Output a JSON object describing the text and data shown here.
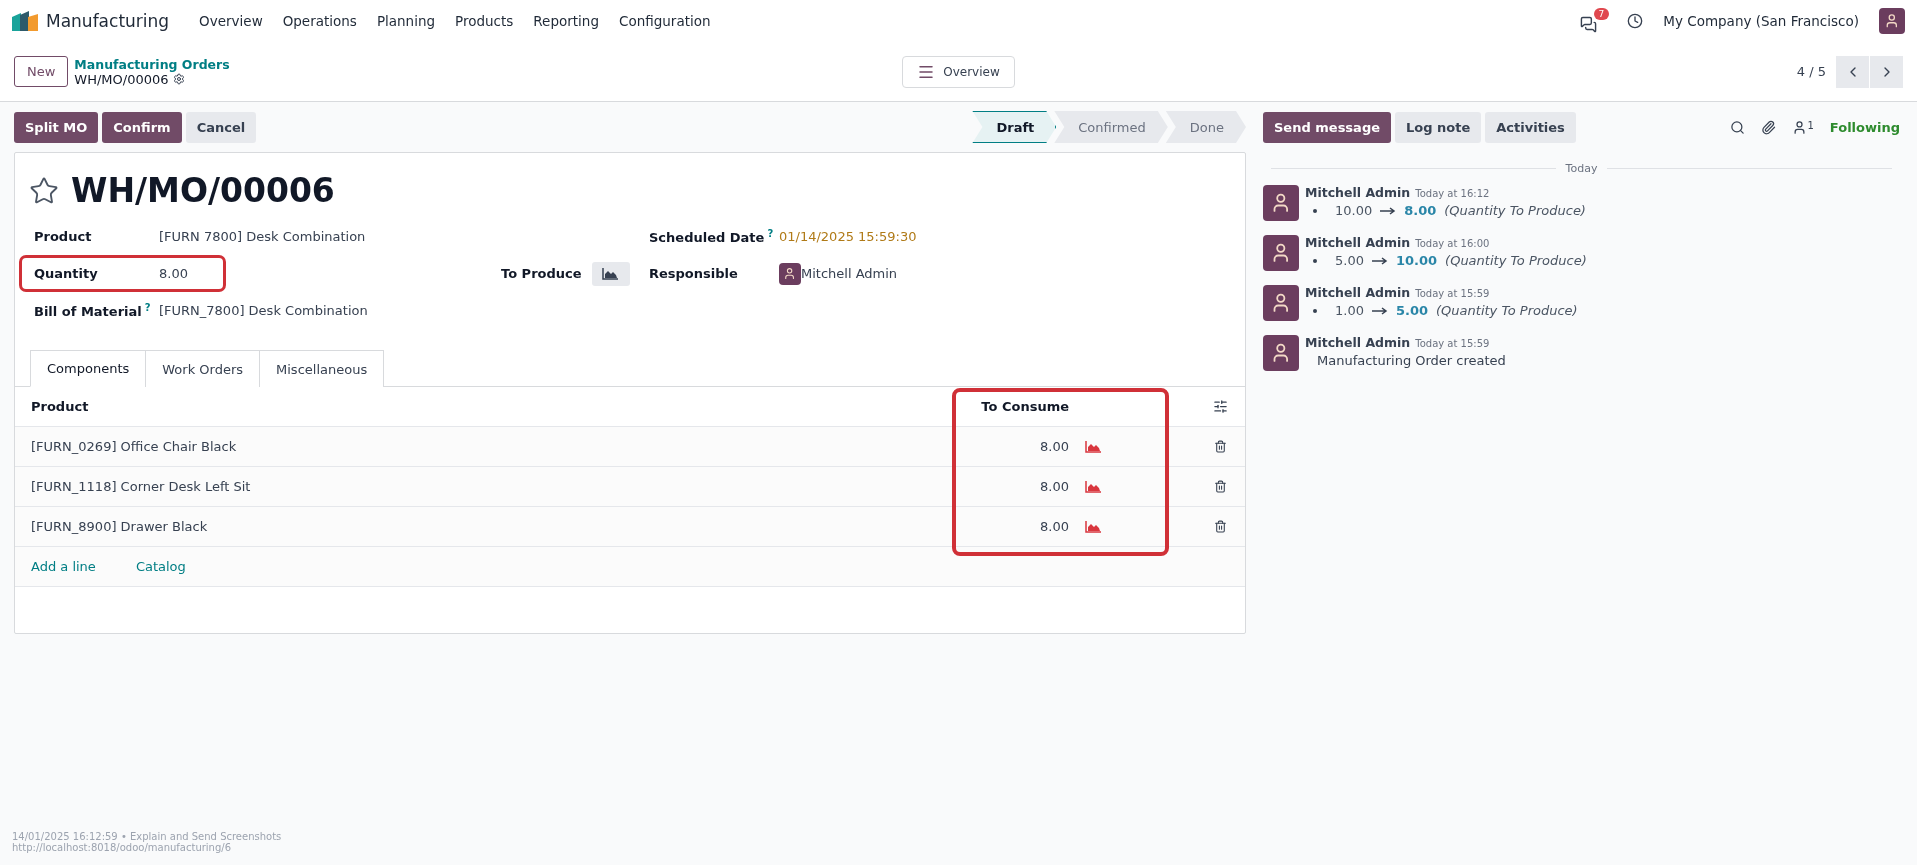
{
  "app": {
    "name": "Manufacturing"
  },
  "menu": [
    "Overview",
    "Operations",
    "Planning",
    "Products",
    "Reporting",
    "Configuration"
  ],
  "systray": {
    "messages_count": "7",
    "company": "My Company (San Francisco)"
  },
  "control_panel": {
    "new_button": "New",
    "breadcrumb": "Manufacturing Orders",
    "record": "WH/MO/00006",
    "view_button": "Overview",
    "pager": "4 / 5"
  },
  "actions": [
    {
      "label": "Split MO",
      "kind": "primary"
    },
    {
      "label": "Confirm",
      "kind": "primary"
    },
    {
      "label": "Cancel",
      "kind": "secondary"
    }
  ],
  "statusbar": [
    {
      "label": "Draft",
      "selected": true
    },
    {
      "label": "Confirmed",
      "selected": false
    },
    {
      "label": "Done",
      "selected": false
    }
  ],
  "form": {
    "title": "WH/MO/00006",
    "starred": false,
    "left_fields": [
      {
        "label": "Product",
        "value": "[FURN 7800] Desk Combination",
        "highlighted": false
      },
      {
        "label": "Quantity",
        "value": "8.00",
        "highlighted": true
      },
      {
        "label": "Bill of Material",
        "help": "?",
        "value": "[FURN_7800] Desk Combination",
        "highlighted": false
      }
    ],
    "to_produce": {
      "label": "To Produce"
    },
    "right_fields": [
      {
        "label": "Scheduled Date",
        "help": "?",
        "value": "01/14/2025 15:59:30",
        "kind": "date"
      },
      {
        "label": "Responsible",
        "value": "Mitchell Admin",
        "kind": "user"
      }
    ],
    "tabs": [
      {
        "label": "Components",
        "selected": true
      },
      {
        "label": "Work Orders",
        "selected": false
      },
      {
        "label": "Miscellaneous",
        "selected": false
      }
    ],
    "table": {
      "columns": [
        {
          "label": "Product"
        },
        {
          "label": "To Consume",
          "highlighted": true
        }
      ],
      "rows": [
        {
          "product": "[FURN_0269] Office Chair Black",
          "to_consume": "8.00"
        },
        {
          "product": "[FURN_1118] Corner Desk Left Sit",
          "to_consume": "8.00"
        },
        {
          "product": "[FURN_8900] Drawer Black",
          "to_consume": "8.00"
        }
      ],
      "links": [
        "Add a line",
        "Catalog"
      ]
    }
  },
  "chatter": {
    "buttons": [
      {
        "label": "Send message",
        "kind": "primary"
      },
      {
        "label": "Log note",
        "kind": "secondary"
      },
      {
        "label": "Activities",
        "kind": "secondary"
      }
    ],
    "followers_count": "1",
    "follow_label": "Following",
    "date_separator": "Today",
    "messages": [
      {
        "kind": "tracking",
        "author": "Mitchell Admin",
        "time": "Today at 16:12",
        "old": "10.00",
        "new": "8.00",
        "field": "(Quantity To Produce)"
      },
      {
        "kind": "tracking",
        "author": "Mitchell Admin",
        "time": "Today at 16:00",
        "old": "5.00",
        "new": "10.00",
        "field": "(Quantity To Produce)"
      },
      {
        "kind": "tracking",
        "author": "Mitchell Admin",
        "time": "Today at 15:59",
        "old": "1.00",
        "new": "5.00",
        "field": "(Quantity To Produce)"
      },
      {
        "kind": "note",
        "author": "Mitchell Admin",
        "time": "Today at 15:59",
        "body": "Manufacturing Order created"
      }
    ]
  },
  "footer": {
    "line_1": "14/01/2025 16:12:59 • Explain and Send Screenshots",
    "line_2": "http://localhost:8018/odoo/manufacturing/6"
  }
}
